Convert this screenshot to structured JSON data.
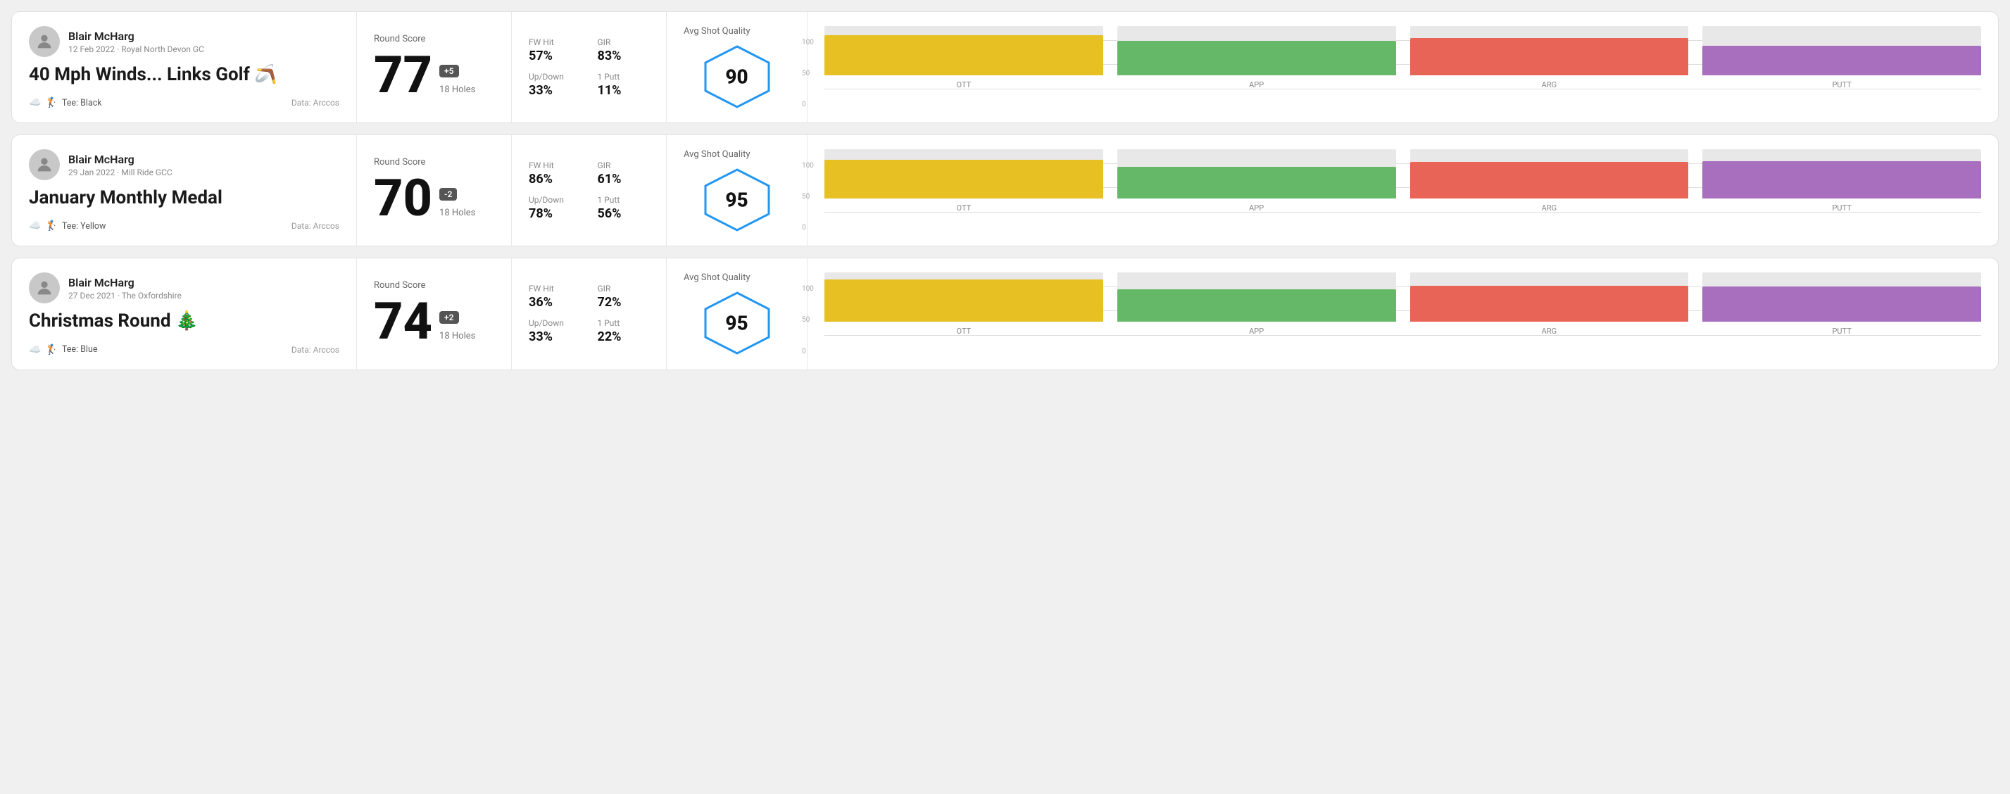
{
  "rounds": [
    {
      "id": "round-1",
      "player_name": "Blair McHarg",
      "player_meta": "12 Feb 2022 · Royal North Devon GC",
      "round_title": "40 Mph Winds... Links Golf 🪃",
      "tee": "Tee: Black",
      "data_source": "Data: Arccos",
      "score": "77",
      "score_badge": "+5",
      "score_badge_type": "positive",
      "holes": "18 Holes",
      "fw_hit": "57%",
      "gir": "83%",
      "up_down": "33%",
      "one_putt": "11%",
      "avg_quality": "90",
      "chart": {
        "ott": {
          "value": 107,
          "bar_pct": 82
        },
        "app": {
          "value": 95,
          "bar_pct": 70
        },
        "arg": {
          "value": 98,
          "bar_pct": 75
        },
        "putt": {
          "value": 82,
          "bar_pct": 60
        }
      }
    },
    {
      "id": "round-2",
      "player_name": "Blair McHarg",
      "player_meta": "29 Jan 2022 · Mill Ride GCC",
      "round_title": "January Monthly Medal",
      "tee": "Tee: Yellow",
      "data_source": "Data: Arccos",
      "score": "70",
      "score_badge": "-2",
      "score_badge_type": "negative",
      "holes": "18 Holes",
      "fw_hit": "86%",
      "gir": "61%",
      "up_down": "78%",
      "one_putt": "56%",
      "avg_quality": "95",
      "chart": {
        "ott": {
          "value": 101,
          "bar_pct": 78
        },
        "app": {
          "value": 86,
          "bar_pct": 64
        },
        "arg": {
          "value": 96,
          "bar_pct": 74
        },
        "putt": {
          "value": 99,
          "bar_pct": 76
        }
      }
    },
    {
      "id": "round-3",
      "player_name": "Blair McHarg",
      "player_meta": "27 Dec 2021 · The Oxfordshire",
      "round_title": "Christmas Round 🎄",
      "tee": "Tee: Blue",
      "data_source": "Data: Arccos",
      "score": "74",
      "score_badge": "+2",
      "score_badge_type": "positive",
      "holes": "18 Holes",
      "fw_hit": "36%",
      "gir": "72%",
      "up_down": "33%",
      "one_putt": "22%",
      "avg_quality": "95",
      "chart": {
        "ott": {
          "value": 110,
          "bar_pct": 85
        },
        "app": {
          "value": 87,
          "bar_pct": 65
        },
        "arg": {
          "value": 95,
          "bar_pct": 73
        },
        "putt": {
          "value": 93,
          "bar_pct": 71
        }
      }
    }
  ],
  "labels": {
    "round_score": "Round Score",
    "fw_hit": "FW Hit",
    "gir": "GIR",
    "up_down": "Up/Down",
    "one_putt": "1 Putt",
    "avg_shot_quality": "Avg Shot Quality",
    "ott": "OTT",
    "app": "APP",
    "arg": "ARG",
    "putt": "PUTT",
    "data_arccos": "Data: Arccos",
    "y_100": "100",
    "y_50": "50",
    "y_0": "0"
  }
}
